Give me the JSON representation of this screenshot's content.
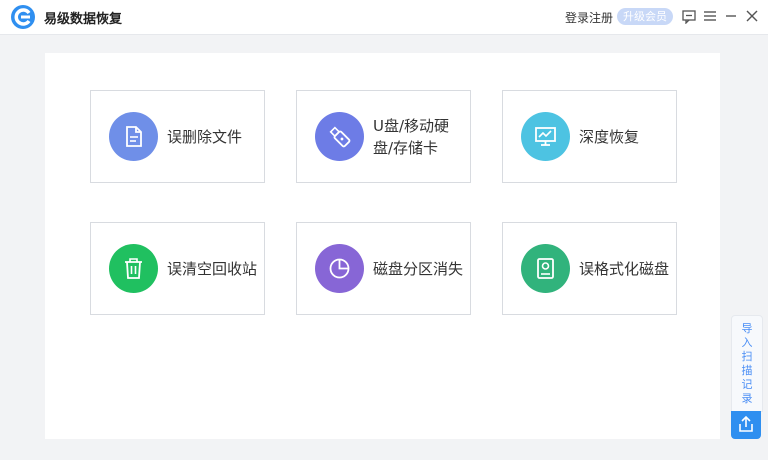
{
  "app": {
    "title": "易级数据恢复"
  },
  "header": {
    "login_label": "登录注册",
    "vip_label": "升级会员",
    "icons": [
      "feedback-icon",
      "menu-icon",
      "minimize-icon",
      "close-icon"
    ]
  },
  "cards": [
    {
      "label": "误删除文件",
      "icon": "document-icon",
      "color": "#6f8fe8"
    },
    {
      "label": "U盘/移动硬盘/存储卡",
      "icon": "usb-drive-icon",
      "color": "#6d7ce6"
    },
    {
      "label": "深度恢复",
      "icon": "monitor-chart-icon",
      "color": "#4dc3e2"
    },
    {
      "label": "误清空回收站",
      "icon": "trash-icon",
      "color": "#20c060"
    },
    {
      "label": "磁盘分区消失",
      "icon": "pie-chart-icon",
      "color": "#8766d6"
    },
    {
      "label": "误格式化磁盘",
      "icon": "hard-disk-icon",
      "color": "#31b37c"
    }
  ],
  "side": {
    "import_label": "导入扫描记录",
    "upload_icon": "upload-icon"
  },
  "colors": {
    "accent": "#2f8ff0",
    "vip_bg": "#c8d8f7"
  }
}
